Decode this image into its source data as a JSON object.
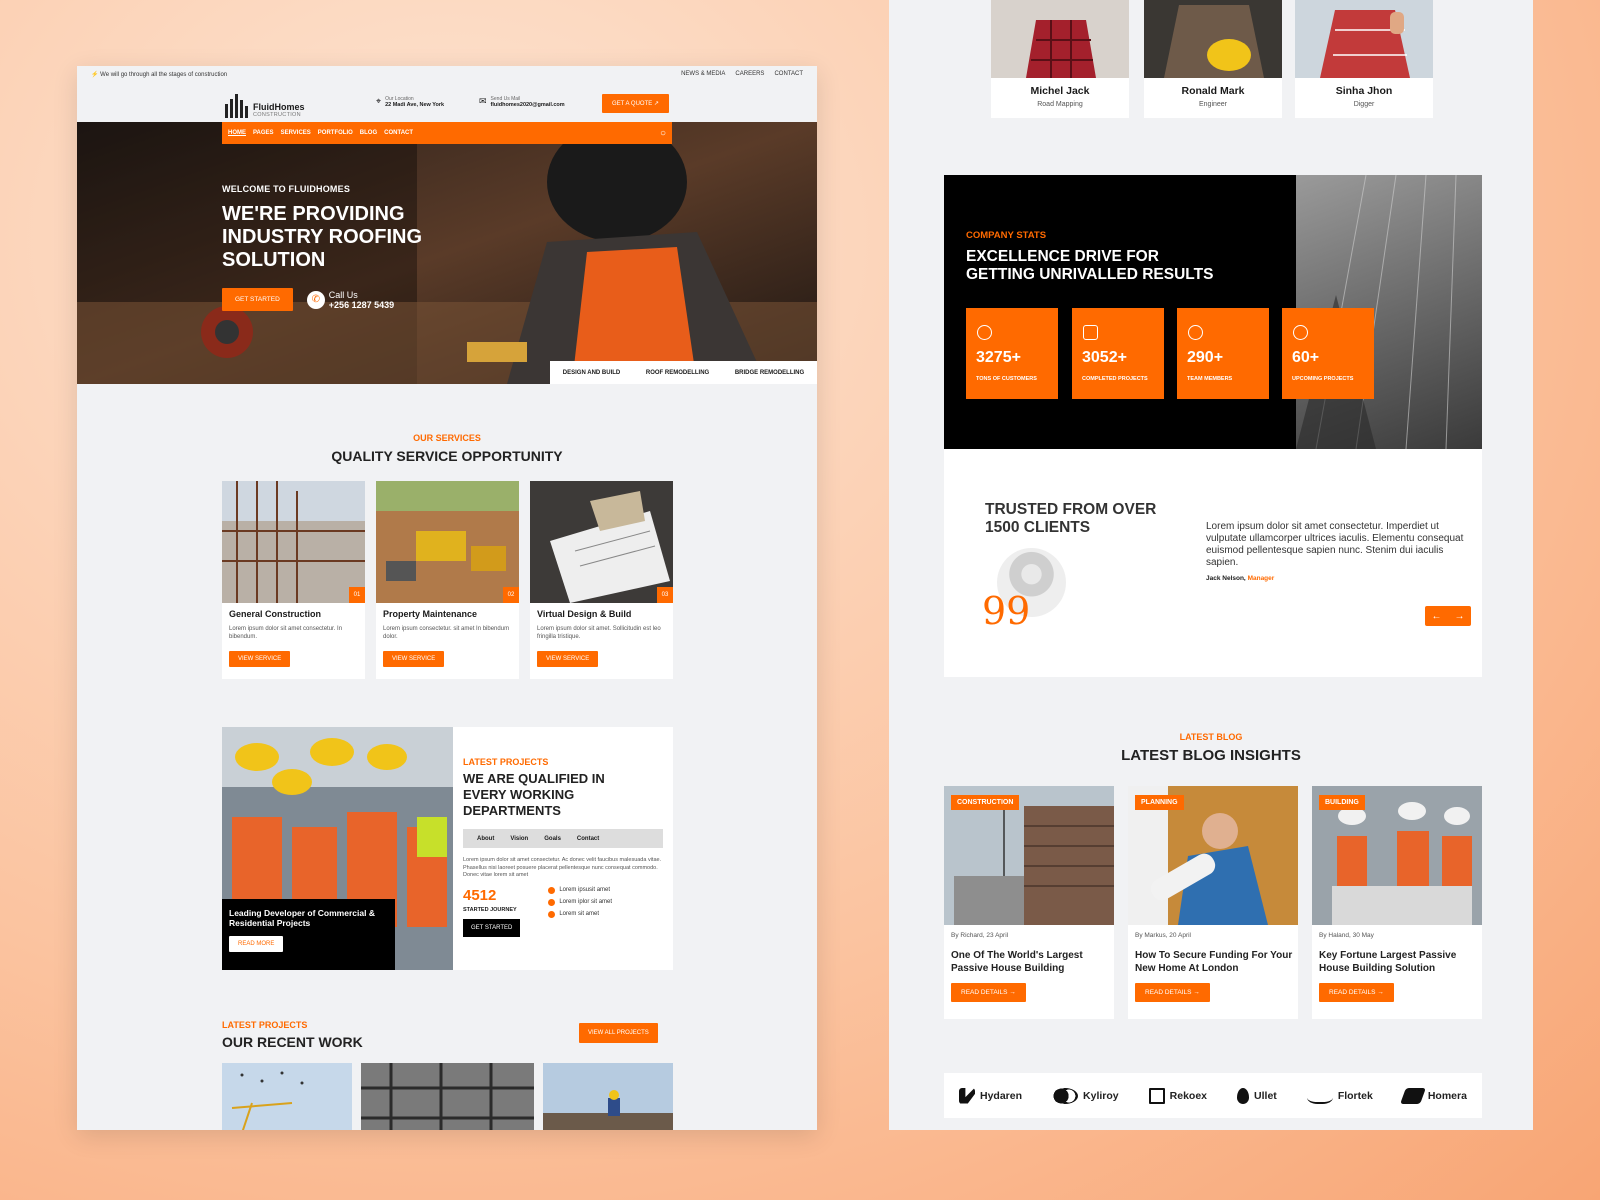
{
  "left": {
    "topbar": {
      "message": "We will go through all the stages of construction",
      "links": [
        "NEWS & MEDIA",
        "CAREERS",
        "CONTACT"
      ]
    },
    "logo": {
      "name": "FluidHomes",
      "sub": "CONSTRUCTION"
    },
    "location": {
      "label": "Our Location",
      "value": "22 Madi Ave, New York"
    },
    "mail": {
      "label": "Send Us Mail",
      "value": "fluidhomes2020@gmail.com"
    },
    "quote_button": "GET A QUOTE",
    "nav": [
      "HOME",
      "PAGES",
      "SERVICES",
      "PORTFOLIO",
      "BLOG",
      "CONTACT"
    ],
    "hero": {
      "pre": "WELCOME TO FLUIDHOMES",
      "title_lines": [
        "WE'RE PROVIDING",
        "INDUSTRY ROOFING",
        "SOLUTION"
      ],
      "cta": "GET STARTED",
      "call_label": "Call Us",
      "call_number": "+256 1287 5439",
      "tabs": [
        "DESIGN AND BUILD",
        "ROOF REMODELLING",
        "BRIDGE REMODELLING"
      ]
    },
    "services": {
      "pre": "OUR SERVICES",
      "title": "QUALITY SERVICE OPPORTUNITY",
      "cards": [
        {
          "num": "01",
          "title": "General Construction",
          "desc": "Lorem ipsum dolor sit amet consectetur. In bibendum.",
          "button": "VIEW SERVICE"
        },
        {
          "num": "02",
          "title": "Property Maintenance",
          "desc": "Lorem ipsum consectetur. sit amet In bibendum dolor.",
          "button": "VIEW SERVICE"
        },
        {
          "num": "03",
          "title": "Virtual Design & Build",
          "desc": "Lorem ipsum dolor sit amet. Sollicitudin est leo fringilla tristique.",
          "button": "VIEW SERVICE"
        }
      ]
    },
    "projects": {
      "caption": "Leading Developer of Commercial & Residential Projects",
      "read_more": "READ MORE",
      "pre": "LATEST PROJECTS",
      "title_lines": [
        "WE ARE QUALIFIED IN",
        "EVERY WORKING",
        "DEPARTMENTS"
      ],
      "tabs": [
        "About",
        "Vision",
        "Goals",
        "Contact"
      ],
      "paragraph": "Lorem ipsum dolor sit amet consectetur. Ac donec velit faucibus malesuada vitae. Phasellus nisi laoreet posuere placerat pellentesque nunc consequat commodo. Donec vitae lorem sit amet",
      "stat_value": "4512",
      "stat_label": "STARTED JOURNEY",
      "checks": [
        "Lorem ipsusit amet",
        "Lorem iplor sit amet",
        "Lorem sit amet"
      ],
      "button": "GET STARTED"
    },
    "recent": {
      "pre": "LATEST PROJECTS",
      "title": "OUR RECENT WORK",
      "button": "VIEW ALL PROJECTS"
    }
  },
  "right": {
    "team": [
      {
        "name": "Michel Jack",
        "role": "Road Mapping"
      },
      {
        "name": "Ronald Mark",
        "role": "Engineer"
      },
      {
        "name": "Sinha Jhon",
        "role": "Digger"
      }
    ],
    "stats": {
      "pre": "COMPANY STATS",
      "title_lines": [
        "EXCELLENCE DRIVE FOR",
        "GETTING UNRIVALLED RESULTS"
      ],
      "items": [
        {
          "value": "3275+",
          "label": "TONS OF CUSTOMERS"
        },
        {
          "value": "3052+",
          "label": "COMPLETED PROJECTS"
        },
        {
          "value": "290+",
          "label": "TEAM MEMBERS"
        },
        {
          "value": "60+",
          "label": "UPCOMING PROJECTS"
        }
      ]
    },
    "testimonial": {
      "title_lines": [
        "TRUSTED FROM OVER",
        "1500 CLIENTS"
      ],
      "quote_mark": "99",
      "text": "Lorem ipsum dolor sit amet consectetur. Imperdiet ut vulputate ullamcorper ultrices iaculis. Elementu consequat euismod pellentesque sapien nunc. Stenim dui iaculis sapien.",
      "author": "Jack Nelson,",
      "role": "Manager"
    },
    "blog": {
      "pre": "LATEST BLOG",
      "title": "LATEST BLOG INSIGHTS",
      "posts": [
        {
          "tag": "CONSTRUCTION",
          "by": "By Richard, 23 April",
          "title": "One Of The World's Largest Passive House Building",
          "button": "READ DETAILS"
        },
        {
          "tag": "PLANNING",
          "by": "By Markus, 20 April",
          "title": "How To Secure Funding For Your New Home At London",
          "button": "READ DETAILS"
        },
        {
          "tag": "BUILDING",
          "by": "By Haland, 30 May",
          "title": "Key Fortune Largest Passive House Building Solution",
          "button": "READ DETAILS"
        }
      ]
    },
    "brands": [
      "Hydaren",
      "Kyliroy",
      "Rekoex",
      "Ullet",
      "Flortek",
      "Homera"
    ]
  }
}
